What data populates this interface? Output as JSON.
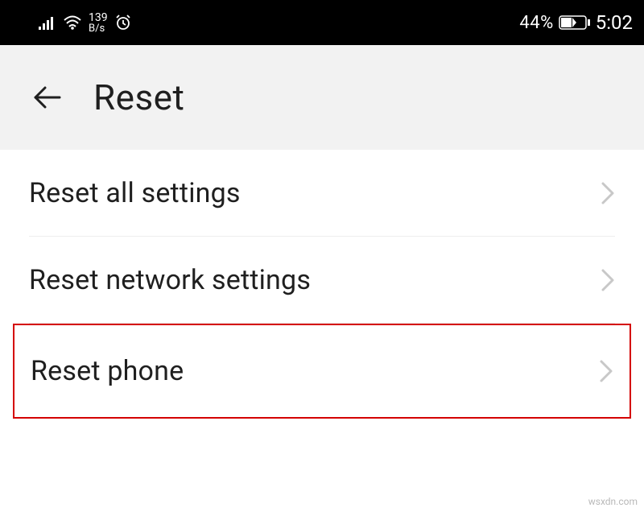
{
  "status_bar": {
    "netspeed_value": "139",
    "netspeed_unit": "B/s",
    "battery_percent": "44%",
    "time": "5:02"
  },
  "header": {
    "title": "Reset"
  },
  "items": [
    {
      "label": "Reset all settings",
      "highlighted": false
    },
    {
      "label": "Reset network settings",
      "highlighted": false
    },
    {
      "label": "Reset phone",
      "highlighted": true
    }
  ],
  "watermark": "wsxdn.com"
}
